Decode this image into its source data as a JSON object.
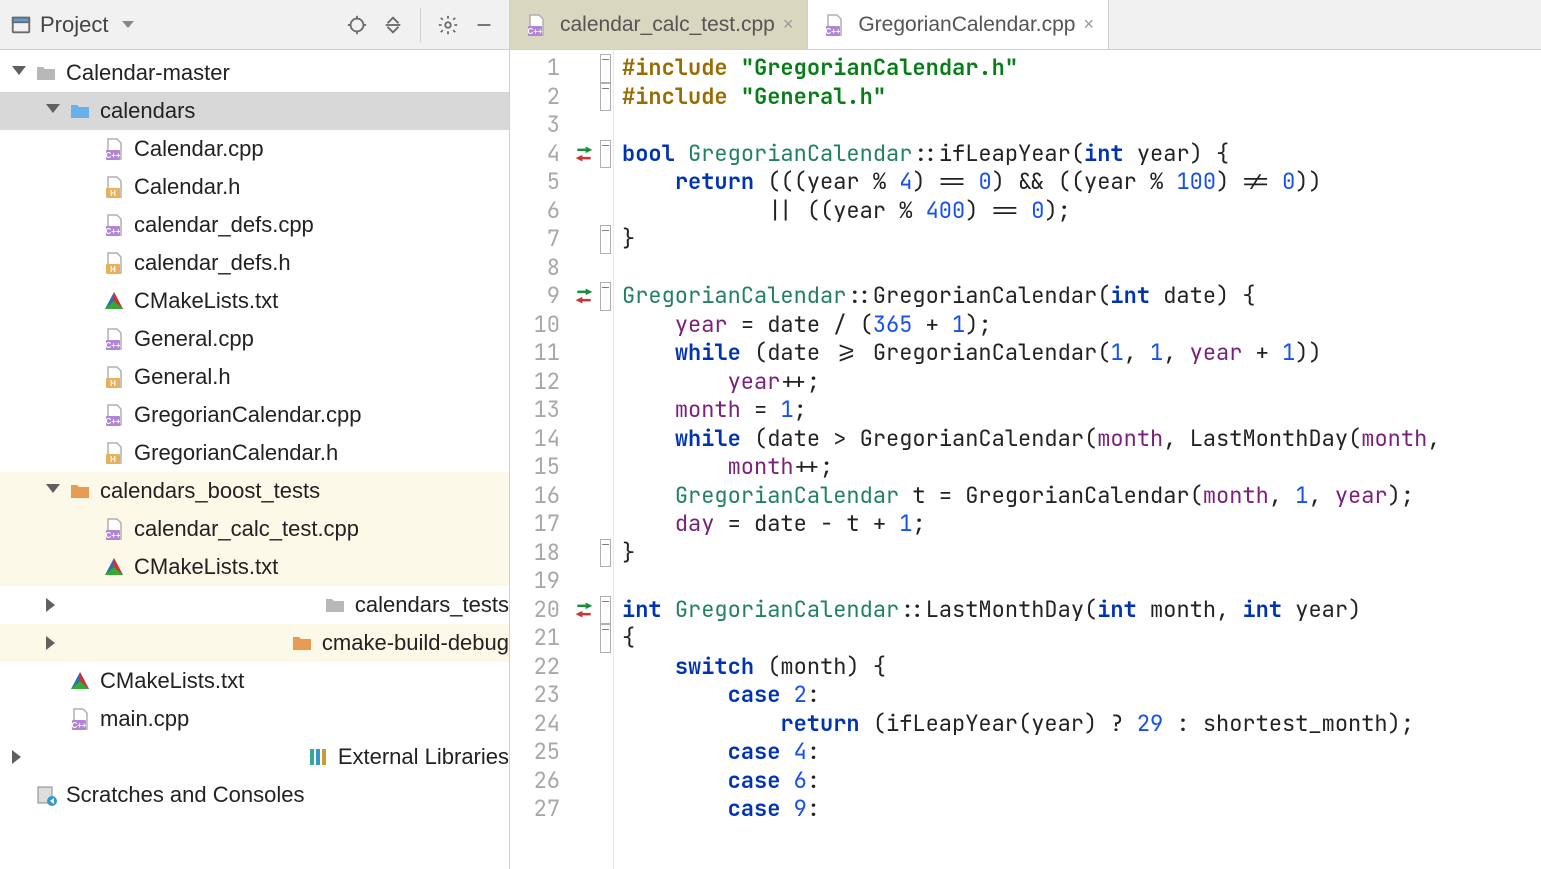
{
  "project_panel": {
    "title": "Project"
  },
  "tree": [
    {
      "id": "root",
      "depth": 0,
      "arrow": "down",
      "icon": "folder-grey",
      "label": "Calendar-master",
      "sel": false,
      "changed": false
    },
    {
      "id": "calendars",
      "depth": 1,
      "arrow": "down",
      "icon": "folder-blue",
      "label": "calendars",
      "sel": true,
      "changed": false
    },
    {
      "id": "cal-cpp",
      "depth": 2,
      "arrow": "none",
      "icon": "cpp",
      "label": "Calendar.cpp",
      "sel": false,
      "changed": false
    },
    {
      "id": "cal-h",
      "depth": 2,
      "arrow": "none",
      "icon": "h",
      "label": "Calendar.h",
      "sel": false,
      "changed": false
    },
    {
      "id": "caldefs-cpp",
      "depth": 2,
      "arrow": "none",
      "icon": "cpp",
      "label": "calendar_defs.cpp",
      "sel": false,
      "changed": false
    },
    {
      "id": "caldefs-h",
      "depth": 2,
      "arrow": "none",
      "icon": "h",
      "label": "calendar_defs.h",
      "sel": false,
      "changed": false
    },
    {
      "id": "cmake1",
      "depth": 2,
      "arrow": "none",
      "icon": "cmake",
      "label": "CMakeLists.txt",
      "sel": false,
      "changed": false
    },
    {
      "id": "gen-cpp",
      "depth": 2,
      "arrow": "none",
      "icon": "cpp",
      "label": "General.cpp",
      "sel": false,
      "changed": false
    },
    {
      "id": "gen-h",
      "depth": 2,
      "arrow": "none",
      "icon": "h",
      "label": "General.h",
      "sel": false,
      "changed": false
    },
    {
      "id": "greg-cpp",
      "depth": 2,
      "arrow": "none",
      "icon": "cpp",
      "label": "GregorianCalendar.cpp",
      "sel": false,
      "changed": false
    },
    {
      "id": "greg-h",
      "depth": 2,
      "arrow": "none",
      "icon": "h",
      "label": "GregorianCalendar.h",
      "sel": false,
      "changed": false
    },
    {
      "id": "boost",
      "depth": 1,
      "arrow": "down",
      "icon": "folder-orange",
      "label": "calendars_boost_tests",
      "sel": false,
      "changed": true
    },
    {
      "id": "calctest",
      "depth": 2,
      "arrow": "none",
      "icon": "cpp",
      "label": "calendar_calc_test.cpp",
      "sel": false,
      "changed": true
    },
    {
      "id": "cmake2",
      "depth": 2,
      "arrow": "none",
      "icon": "cmake",
      "label": "CMakeLists.txt",
      "sel": false,
      "changed": true
    },
    {
      "id": "tests",
      "depth": 1,
      "arrow": "right",
      "icon": "folder-grey",
      "label": "calendars_tests",
      "sel": false,
      "changed": false
    },
    {
      "id": "cbd",
      "depth": 1,
      "arrow": "right",
      "icon": "folder-orange",
      "label": "cmake-build-debug",
      "sel": false,
      "changed": true
    },
    {
      "id": "cmake3",
      "depth": 1,
      "arrow": "none",
      "icon": "cmake",
      "label": "CMakeLists.txt",
      "sel": false,
      "changed": false
    },
    {
      "id": "main",
      "depth": 1,
      "arrow": "none",
      "icon": "cpp",
      "label": "main.cpp",
      "sel": false,
      "changed": false
    },
    {
      "id": "extlib",
      "depth": 0,
      "arrow": "right",
      "icon": "extlib",
      "label": "External Libraries",
      "sel": false,
      "changed": false
    },
    {
      "id": "scratch",
      "depth": 0,
      "arrow": "none",
      "icon": "scratch",
      "label": "Scratches and Consoles",
      "sel": false,
      "changed": false
    }
  ],
  "tabs": [
    {
      "id": "t1",
      "label": "calendar_calc_test.cpp",
      "icon": "cpp",
      "active": false
    },
    {
      "id": "t2",
      "label": "GregorianCalendar.cpp",
      "icon": "cpp",
      "active": true
    }
  ],
  "gutter_start": 1,
  "gutter_end": 27,
  "markers": {
    "4": "change",
    "9": "change",
    "20": "change"
  },
  "folds": {
    "1": true,
    "2": true,
    "4": true,
    "7": true,
    "9": true,
    "18": true,
    "20": true,
    "21": true
  },
  "code_lines": [
    [
      {
        "c": "pp",
        "t": "#include "
      },
      {
        "c": "str",
        "t": "\"GregorianCalendar.h\""
      }
    ],
    [
      {
        "c": "pp",
        "t": "#include "
      },
      {
        "c": "str",
        "t": "\"General.h\""
      }
    ],
    [
      {
        "t": ""
      }
    ],
    [
      {
        "c": "kw",
        "t": "bool "
      },
      {
        "c": "type",
        "t": "GregorianCalendar"
      },
      {
        "t": "::ifLeapYear("
      },
      {
        "c": "kw",
        "t": "int"
      },
      {
        "t": " year) {"
      }
    ],
    [
      {
        "t": "    "
      },
      {
        "c": "kw",
        "t": "return"
      },
      {
        "t": " (((year % "
      },
      {
        "c": "num",
        "t": "4"
      },
      {
        "t": ") == "
      },
      {
        "c": "num",
        "t": "0"
      },
      {
        "t": ") && ((year % "
      },
      {
        "c": "num",
        "t": "100"
      },
      {
        "t": ") != "
      },
      {
        "c": "num",
        "t": "0"
      },
      {
        "t": "))"
      }
    ],
    [
      {
        "t": "           || ((year % "
      },
      {
        "c": "num",
        "t": "400"
      },
      {
        "t": ") == "
      },
      {
        "c": "num",
        "t": "0"
      },
      {
        "t": ");"
      }
    ],
    [
      {
        "t": "}"
      }
    ],
    [
      {
        "t": ""
      }
    ],
    [
      {
        "c": "type",
        "t": "GregorianCalendar"
      },
      {
        "t": "::GregorianCalendar("
      },
      {
        "c": "kw",
        "t": "int"
      },
      {
        "t": " date) {"
      }
    ],
    [
      {
        "t": "    "
      },
      {
        "c": "mem",
        "t": "year"
      },
      {
        "t": " = date / ("
      },
      {
        "c": "num",
        "t": "365"
      },
      {
        "t": " + "
      },
      {
        "c": "num",
        "t": "1"
      },
      {
        "t": ");"
      }
    ],
    [
      {
        "t": "    "
      },
      {
        "c": "kw",
        "t": "while"
      },
      {
        "t": " (date >= GregorianCalendar("
      },
      {
        "c": "num",
        "t": "1"
      },
      {
        "t": ", "
      },
      {
        "c": "num",
        "t": "1"
      },
      {
        "t": ", "
      },
      {
        "c": "mem",
        "t": "year"
      },
      {
        "t": " + "
      },
      {
        "c": "num",
        "t": "1"
      },
      {
        "t": "))"
      }
    ],
    [
      {
        "t": "        "
      },
      {
        "c": "mem",
        "t": "year"
      },
      {
        "t": "++;"
      }
    ],
    [
      {
        "t": "    "
      },
      {
        "c": "mem",
        "t": "month"
      },
      {
        "t": " = "
      },
      {
        "c": "num",
        "t": "1"
      },
      {
        "t": ";"
      }
    ],
    [
      {
        "t": "    "
      },
      {
        "c": "kw",
        "t": "while"
      },
      {
        "t": " (date > GregorianCalendar("
      },
      {
        "c": "mem",
        "t": "month"
      },
      {
        "t": ", LastMonthDay("
      },
      {
        "c": "mem",
        "t": "month"
      },
      {
        "t": ","
      }
    ],
    [
      {
        "t": "        "
      },
      {
        "c": "mem",
        "t": "month"
      },
      {
        "t": "++;"
      }
    ],
    [
      {
        "t": "    "
      },
      {
        "c": "type",
        "t": "GregorianCalendar"
      },
      {
        "t": " t = GregorianCalendar("
      },
      {
        "c": "mem",
        "t": "month"
      },
      {
        "t": ", "
      },
      {
        "c": "num",
        "t": "1"
      },
      {
        "t": ", "
      },
      {
        "c": "mem",
        "t": "year"
      },
      {
        "t": ");"
      }
    ],
    [
      {
        "t": "    "
      },
      {
        "c": "mem",
        "t": "day"
      },
      {
        "t": " = date - t + "
      },
      {
        "c": "num",
        "t": "1"
      },
      {
        "t": ";"
      }
    ],
    [
      {
        "t": "}"
      }
    ],
    [
      {
        "t": ""
      }
    ],
    [
      {
        "c": "kw",
        "t": "int "
      },
      {
        "c": "type",
        "t": "GregorianCalendar"
      },
      {
        "t": "::LastMonthDay("
      },
      {
        "c": "kw",
        "t": "int"
      },
      {
        "t": " month, "
      },
      {
        "c": "kw",
        "t": "int"
      },
      {
        "t": " year)"
      }
    ],
    [
      {
        "t": "{"
      }
    ],
    [
      {
        "t": "    "
      },
      {
        "c": "kw",
        "t": "switch"
      },
      {
        "t": " (month) {"
      }
    ],
    [
      {
        "t": "        "
      },
      {
        "c": "kw",
        "t": "case"
      },
      {
        "t": " "
      },
      {
        "c": "num",
        "t": "2"
      },
      {
        "t": ":"
      }
    ],
    [
      {
        "t": "            "
      },
      {
        "c": "kw",
        "t": "return"
      },
      {
        "t": " (ifLeapYear(year) ? "
      },
      {
        "c": "num",
        "t": "29"
      },
      {
        "t": " : shortest_month);"
      }
    ],
    [
      {
        "t": "        "
      },
      {
        "c": "kw",
        "t": "case"
      },
      {
        "t": " "
      },
      {
        "c": "num",
        "t": "4"
      },
      {
        "t": ":"
      }
    ],
    [
      {
        "t": "        "
      },
      {
        "c": "kw",
        "t": "case"
      },
      {
        "t": " "
      },
      {
        "c": "num",
        "t": "6"
      },
      {
        "t": ":"
      }
    ],
    [
      {
        "t": "        "
      },
      {
        "c": "kw",
        "t": "case"
      },
      {
        "t": " "
      },
      {
        "c": "num",
        "t": "9"
      },
      {
        "t": ":"
      }
    ]
  ]
}
